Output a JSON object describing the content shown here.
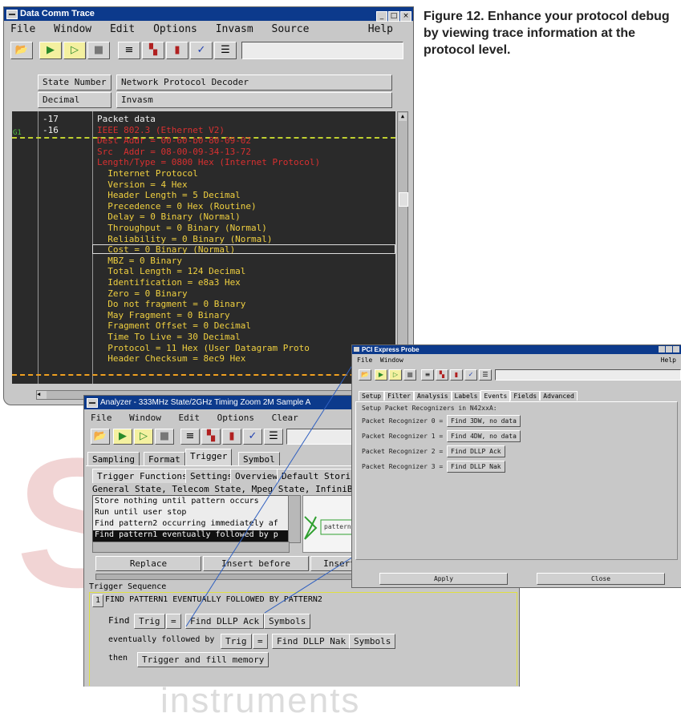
{
  "watermark": {
    "text_big": "SILabs",
    "text_sub": "test & measurement instruments"
  },
  "caption": "Figure 12. Enhance your protocol debug by viewing trace information at the protocol level.",
  "dct": {
    "title": "Data Comm Trace",
    "menu": [
      "File",
      "Window",
      "Edit",
      "Options",
      "Invasm",
      "Source"
    ],
    "help": "Help",
    "header": {
      "col1": "State Number",
      "col2": "Network Protocol Decoder",
      "col1_mode": "Decimal",
      "col2_mode": "Invasm"
    },
    "marker_label": "G1",
    "rows": [
      {
        "num": "-17",
        "text": "Packet data",
        "color": "#f2f2f2"
      },
      {
        "num": "-16",
        "text": "IEEE 802.3 (Ethernet V2)",
        "color": "#d83030"
      },
      {
        "num": "",
        "text": "Dest Addr = 00-60-b0-80-09-02",
        "color": "#d83030"
      },
      {
        "num": "",
        "text": "Src  Addr = 08-00-09-34-13-72",
        "color": "#d83030"
      },
      {
        "num": "",
        "text": "Length/Type = 0800 Hex (Internet Protocol)",
        "color": "#d83030"
      },
      {
        "num": "",
        "text": "  Internet Protocol",
        "color": "#f0d040"
      },
      {
        "num": "",
        "text": "  Version = 4 Hex",
        "color": "#f0d040"
      },
      {
        "num": "",
        "text": "  Header Length = 5 Decimal",
        "color": "#f0d040"
      },
      {
        "num": "",
        "text": "  Precedence = 0 Hex (Routine)",
        "color": "#f0d040"
      },
      {
        "num": "",
        "text": "  Delay = 0 Binary (Normal)",
        "color": "#f0d040"
      },
      {
        "num": "",
        "text": "  Throughput = 0 Binary (Normal)",
        "color": "#f0d040"
      },
      {
        "num": "",
        "text": "  Reliability = 0 Binary (Normal)",
        "color": "#f0d040"
      },
      {
        "num": "",
        "text": "  Cost = 0 Binary (Normal)",
        "color": "#f0d040"
      },
      {
        "num": "",
        "text": "  MBZ = 0 Binary",
        "color": "#f0d040"
      },
      {
        "num": "",
        "text": "  Total Length = 124 Decimal",
        "color": "#f0d040"
      },
      {
        "num": "",
        "text": "  Identification = e8a3 Hex",
        "color": "#f0d040"
      },
      {
        "num": "",
        "text": "  Zero = 0 Binary",
        "color": "#f0d040"
      },
      {
        "num": "",
        "text": "  Do not fragment = 0 Binary",
        "color": "#f0d040"
      },
      {
        "num": "",
        "text": "  May Fragment = 0 Binary",
        "color": "#f0d040"
      },
      {
        "num": "",
        "text": "  Fragment Offset = 0 Decimal",
        "color": "#f0d040"
      },
      {
        "num": "",
        "text": "  Time To Live = 30 Decimal",
        "color": "#f0d040"
      },
      {
        "num": "",
        "text": "  Protocol = 11 Hex (User Datagram Proto",
        "color": "#f0d040"
      },
      {
        "num": "",
        "text": "  Header Checksum = 8ec9 Hex",
        "color": "#f0d040"
      }
    ]
  },
  "analyzer": {
    "title": "Analyzer - 333MHz State/2GHz Timing Zoom 2M Sample A",
    "menu": [
      "File",
      "Window",
      "Edit",
      "Options",
      "Clear"
    ],
    "tabs": [
      "Sampling",
      "Format",
      "Trigger",
      "Symbol"
    ],
    "subtabs": [
      "Trigger Functions",
      "Settings",
      "Overview",
      "Default Storing"
    ],
    "state_line": "General State, Telecom State, Mpeg State, InfiniBand",
    "functions": [
      "Store nothing until pattern occurs",
      "Run until user stop",
      "Find pattern2 occurring immediately af",
      "Find pattern1 eventually followed by p"
    ],
    "diagram_label": "pattern",
    "buttons": {
      "replace": "Replace",
      "insert_before": "Insert before",
      "insert_after": "Insert"
    },
    "seq_label": "Trigger Sequence",
    "seq_num": "1",
    "seq_title": "FIND PATTERN1 EVENTUALLY FOLLOWED BY PATTERN2",
    "find_label": "Find",
    "trig1": "Trig",
    "eq1": "=",
    "val1": "Find DLLP Ack",
    "symbols1": "Symbols",
    "followed_label": "eventually followed by",
    "trig2": "Trig",
    "eq2": "=",
    "val2": "Find DLLP Nak",
    "symbols2": "Symbols",
    "then_label": "then",
    "action": "Trigger and fill memory"
  },
  "pci": {
    "title": "PCI Express Probe",
    "menu": [
      "File",
      "Window"
    ],
    "help": "Help",
    "tabs": [
      "Setup",
      "Filter",
      "Analysis",
      "Labels",
      "Events",
      "Fields",
      "Advanced"
    ],
    "heading": "Setup Packet Recognizers in N42xxA:",
    "recognizers": [
      {
        "label": "Packet Recognizer 0 =",
        "value": "Find 3DW, no data"
      },
      {
        "label": "Packet Recognizer 1 =",
        "value": "Find 4DW, no data"
      },
      {
        "label": "Packet Recognizer 2 =",
        "value": "Find DLLP Ack"
      },
      {
        "label": "Packet Recognizer 3 =",
        "value": "Find DLLP Nak"
      }
    ],
    "apply": "Apply",
    "close": "Close"
  }
}
